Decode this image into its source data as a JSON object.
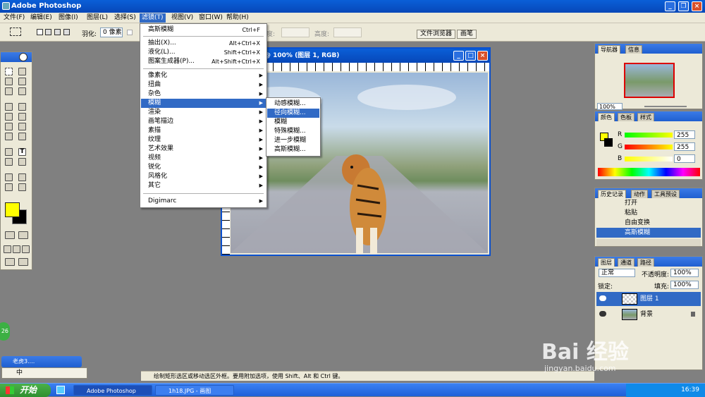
{
  "app": {
    "title": "Adobe Photoshop"
  },
  "menubar": [
    "文件(F)",
    "编辑(E)",
    "图像(I)",
    "图层(L)",
    "选择(S)",
    "滤镜(T)",
    "视图(V)",
    "窗口(W)",
    "帮助(H)"
  ],
  "options": {
    "feather_label": "羽化:",
    "feather_value": "0 像素",
    "width_label": "度:",
    "height_label": "高度:",
    "file_browser": "文件浏览器",
    "brushes": "画笔"
  },
  "document": {
    "title": "@ 100% (图层 1, RGB)"
  },
  "filter_menu": {
    "top": [
      {
        "label": "高斯模糊",
        "shortcut": "Ctrl+F"
      }
    ],
    "group2": [
      {
        "label": "抽出(X)...",
        "shortcut": "Alt+Ctrl+X"
      },
      {
        "label": "液化(L)...",
        "shortcut": "Shift+Ctrl+X"
      },
      {
        "label": "图案生成器(P)...",
        "shortcut": "Alt+Shift+Ctrl+X"
      }
    ],
    "group3": [
      "像素化",
      "扭曲",
      "杂色",
      "模糊",
      "渲染",
      "画笔描边",
      "素描",
      "纹理",
      "艺术效果",
      "视频",
      "锐化",
      "风格化",
      "其它"
    ],
    "bottom": [
      "Digimarc"
    ],
    "highlighted": "模糊"
  },
  "blur_submenu": {
    "items": [
      "动感模糊...",
      "径向模糊...",
      "模糊",
      "特殊模糊...",
      "进一步模糊",
      "高斯模糊..."
    ],
    "highlighted": "径向模糊..."
  },
  "navigator": {
    "tabs": [
      "导航器",
      "信息"
    ],
    "zoom": "100%"
  },
  "color": {
    "tabs": [
      "颜色",
      "色板",
      "样式"
    ],
    "r_label": "R",
    "r": "255",
    "g_label": "G",
    "g": "255",
    "b_label": "B",
    "b": "0"
  },
  "history": {
    "tabs": [
      "历史记录",
      "动作",
      "工具预设"
    ],
    "items": [
      "打开",
      "粘贴",
      "自由变换",
      "高斯模糊"
    ],
    "selected": "高斯模糊"
  },
  "layers": {
    "tabs": [
      "图层",
      "通道",
      "路径"
    ],
    "blend": "正常",
    "opacity_label": "不透明度:",
    "opacity": "100%",
    "lock_label": "锁定:",
    "fill_label": "填充:",
    "fill": "100%",
    "items": [
      "图层 1",
      "背景"
    ],
    "selected": "图层 1"
  },
  "status": {
    "text": "绘制矩形选区或移动选区外框。要用附加选项，使用 Shift、Alt 和 Ctrl 键。"
  },
  "ime": {
    "title": "老虎3....",
    "mode": "中"
  },
  "taskbar": {
    "start": "开始",
    "tasks": [
      "Adobe Photoshop",
      "1h18.JPG - 画图"
    ],
    "clock": "16:39"
  },
  "badge": "26",
  "watermark": {
    "brand": "Bai 经验",
    "url": "jingyan.baidu.com"
  },
  "colors": {
    "xp_blue": "#0a5fd8",
    "menu_highlight": "#316ac5",
    "fg_swatch": "#ffff00",
    "bg_swatch": "#000000"
  }
}
